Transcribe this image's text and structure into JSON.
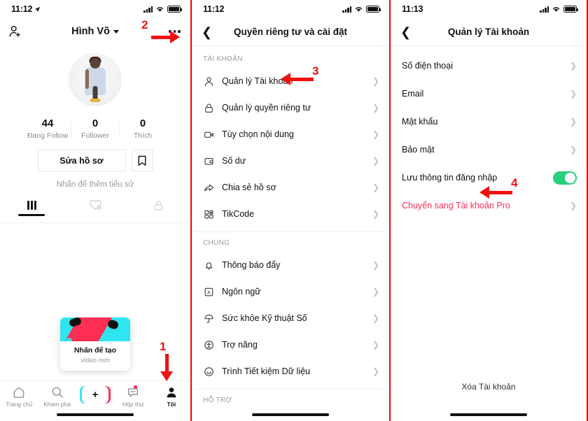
{
  "screens": [
    {
      "status": {
        "time": "11:12",
        "location_arrow": "✈"
      },
      "header": {
        "name": "Hình Võ",
        "add_friend_icon": "person-add-icon",
        "more_icon": "more-options-icon"
      },
      "stats": [
        {
          "value": "44",
          "label": "Đang Follow"
        },
        {
          "value": "0",
          "label": "Follower"
        },
        {
          "value": "0",
          "label": "Thích"
        }
      ],
      "edit_profile_label": "Sửa hồ sơ",
      "bookmark_icon": "bookmark-icon",
      "bio_placeholder": "Nhấn để thêm tiểu sử",
      "tabs": [
        {
          "icon": "grid-icon",
          "active": true
        },
        {
          "icon": "heart-liked-icon",
          "active": false
        },
        {
          "icon": "lock-private-icon",
          "active": false
        }
      ],
      "tooltip": {
        "line1": "Nhấn để tạo",
        "line2": "video mới"
      },
      "bottom_nav": [
        {
          "icon": "home-icon",
          "label": "Trang chủ",
          "active": false
        },
        {
          "icon": "search-icon",
          "label": "Khám phá",
          "active": false
        },
        {
          "icon": "plus-icon",
          "label": "",
          "active": false
        },
        {
          "icon": "inbox-icon",
          "label": "Hộp thư",
          "active": false
        },
        {
          "icon": "profile-icon",
          "label": "Tôi",
          "active": true
        }
      ]
    },
    {
      "status": {
        "time": "11:12"
      },
      "nav": {
        "back_icon": "back-chevron-icon",
        "title": "Quyền riêng tư và cài đặt"
      },
      "sections": [
        {
          "heading": "TÀI KHOẢN",
          "rows": [
            {
              "icon": "person-icon",
              "label": "Quản lý Tài khoản"
            },
            {
              "icon": "lock-icon",
              "label": "Quản lý quyền riêng tư"
            },
            {
              "icon": "video-icon",
              "label": "Tùy chọn nội dung"
            },
            {
              "icon": "wallet-icon",
              "label": "Số dư"
            },
            {
              "icon": "share-icon",
              "label": "Chia sẻ hồ sơ"
            },
            {
              "icon": "qr-icon",
              "label": "TikCode"
            }
          ]
        },
        {
          "heading": "CHUNG",
          "rows": [
            {
              "icon": "bell-icon",
              "label": "Thông báo đẩy"
            },
            {
              "icon": "language-icon",
              "label": "Ngôn ngữ"
            },
            {
              "icon": "umbrella-icon",
              "label": "Sức khỏe Kỹ thuật Số"
            },
            {
              "icon": "accessibility-icon",
              "label": "Trợ năng"
            },
            {
              "icon": "data-saver-icon",
              "label": "Trình Tiết kiệm Dữ liệu"
            }
          ]
        },
        {
          "heading": "HỖ TRỢ",
          "rows": []
        }
      ]
    },
    {
      "status": {
        "time": "11:13"
      },
      "nav": {
        "back_icon": "back-chevron-icon",
        "title": "Quản lý Tài khoản"
      },
      "rows": [
        {
          "label": "Số điện thoại",
          "type": "chevron"
        },
        {
          "label": "Email",
          "type": "chevron"
        },
        {
          "label": "Mật khẩu",
          "type": "chevron"
        },
        {
          "label": "Bảo mật",
          "type": "chevron"
        },
        {
          "label": "Lưu thông tin đăng nhập",
          "type": "toggle",
          "toggle_on": true
        },
        {
          "label": "Chuyển sang Tài khoản Pro",
          "type": "chevron",
          "accent": true
        }
      ],
      "delete_label": "Xóa Tài khoản"
    }
  ],
  "annotations": [
    {
      "number": "1",
      "target": "profile-tab"
    },
    {
      "number": "2",
      "target": "more-options"
    },
    {
      "number": "3",
      "target": "manage-account-row"
    },
    {
      "number": "4",
      "target": "switch-pro-row"
    }
  ],
  "colors": {
    "accent": "#fe2c55",
    "annotation": "#f01010",
    "toggle_on": "#28d17c",
    "cyan": "#2ee6f0"
  }
}
